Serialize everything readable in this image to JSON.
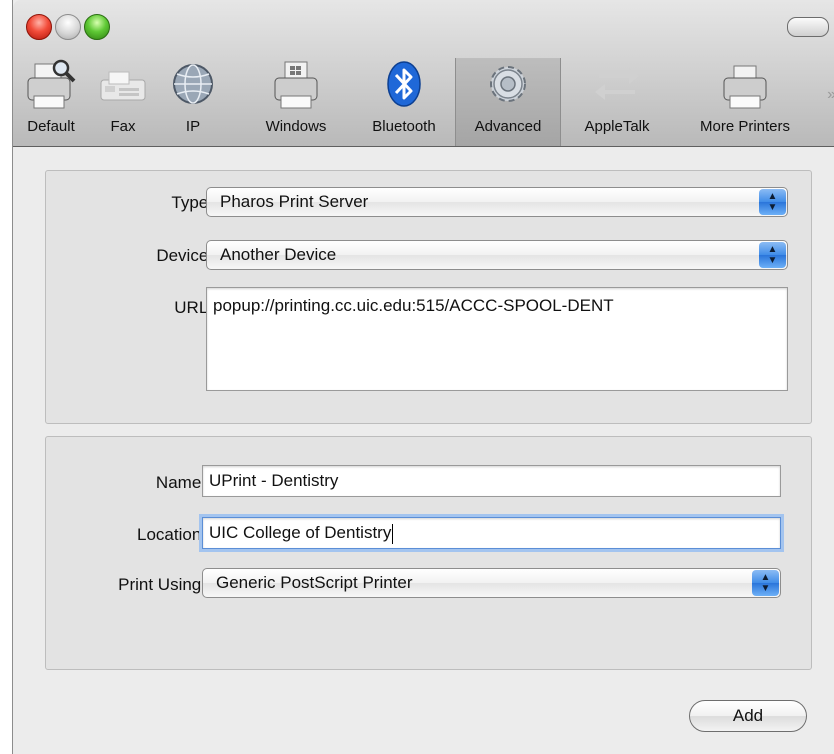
{
  "toolbar": {
    "items": [
      {
        "label": "Default",
        "icon": "printer-magnifier-icon"
      },
      {
        "label": "Fax",
        "icon": "fax-icon"
      },
      {
        "label": "IP",
        "icon": "globe-icon"
      },
      {
        "label": "Windows",
        "icon": "windows-printer-icon"
      },
      {
        "label": "Bluetooth",
        "icon": "bluetooth-icon"
      },
      {
        "label": "Advanced",
        "icon": "gear-icon",
        "selected": true
      },
      {
        "label": "AppleTalk",
        "icon": "arrows-icon"
      },
      {
        "label": "More Printers",
        "icon": "printer-icon"
      }
    ],
    "overflow_glyph": "»"
  },
  "connection": {
    "type_label": "Type:",
    "type_value": "Pharos Print Server",
    "device_label": "Device:",
    "device_value": "Another Device",
    "url_label": "URL:",
    "url_value": "popup://printing.cc.uic.edu:515/ACCC-SPOOL-DENT"
  },
  "printer": {
    "name_label": "Name:",
    "name_value": "UPrint - Dentistry",
    "location_label": "Location:",
    "location_value": "UIC College of Dentistry",
    "print_using_label": "Print Using:",
    "print_using_value": "Generic PostScript Printer"
  },
  "actions": {
    "add_label": "Add"
  },
  "colors": {
    "window_bg": "#ececec",
    "accent_blue": "#3f8ce8",
    "bluetooth_blue": "#1f68d8",
    "focus_ring": "#a3c4ef"
  }
}
